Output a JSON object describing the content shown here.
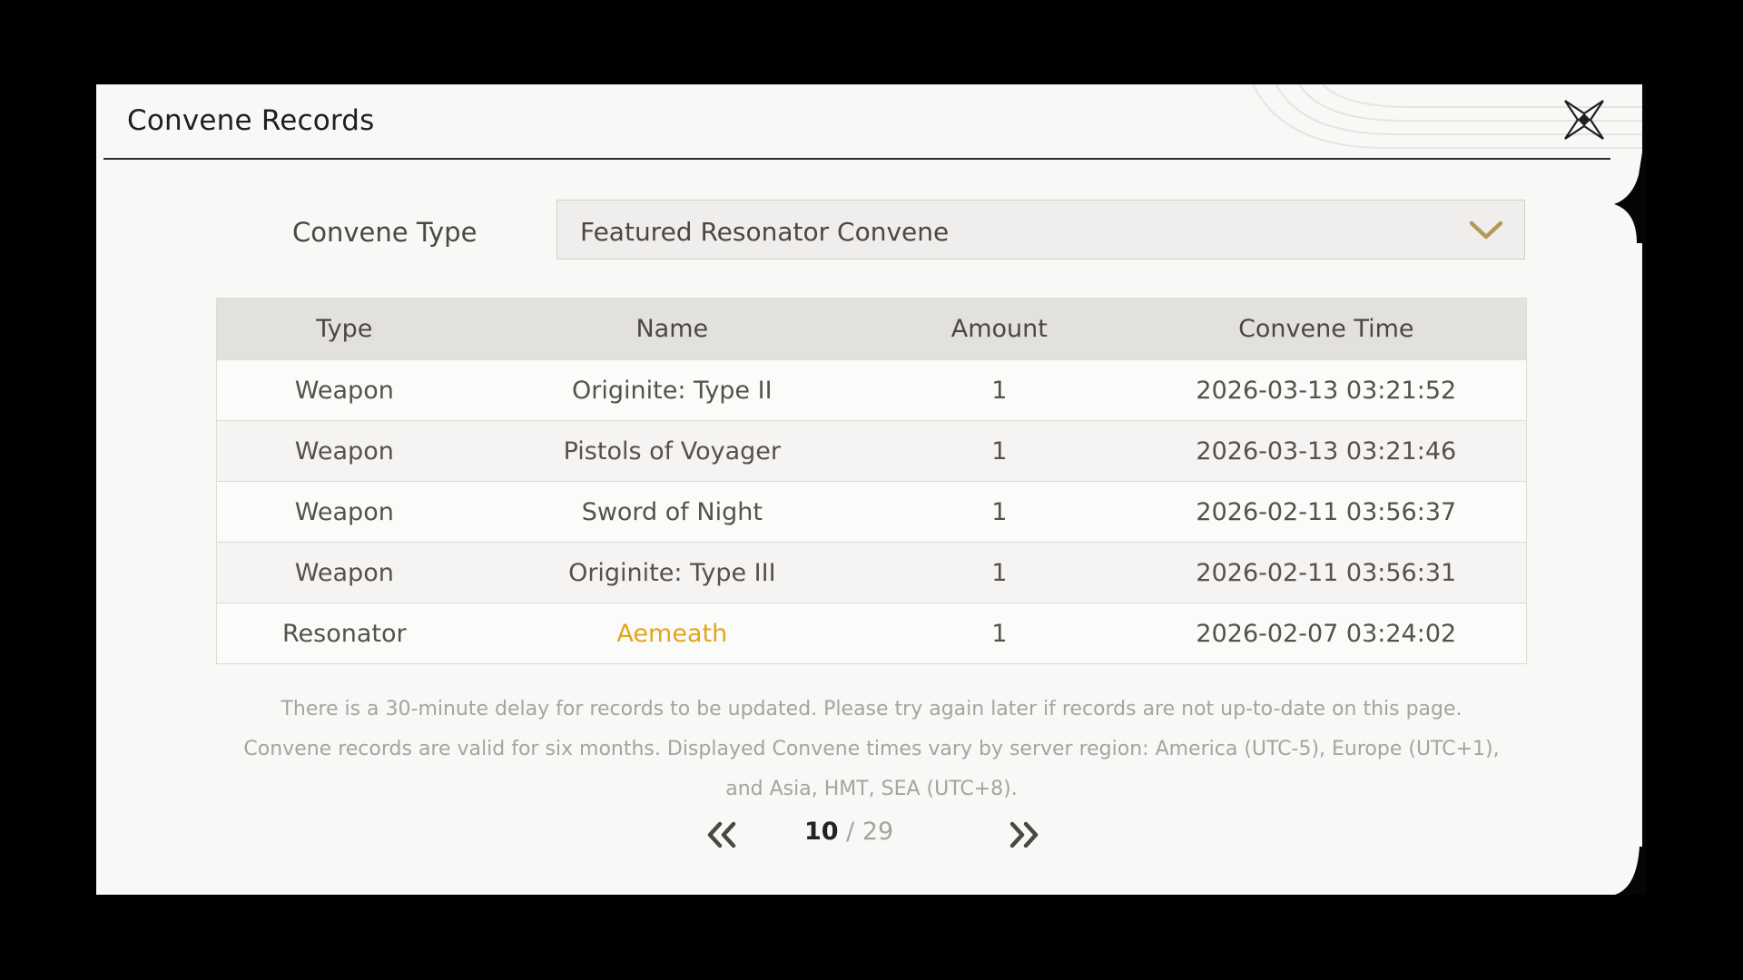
{
  "dialog": {
    "title": "Convene Records"
  },
  "filter": {
    "label": "Convene Type",
    "selected": "Featured Resonator Convene"
  },
  "table": {
    "columns": [
      "Type",
      "Name",
      "Amount",
      "Convene Time"
    ],
    "rows": [
      {
        "type": "Weapon",
        "name": "Originite: Type II",
        "amount": "1",
        "time": "2026-03-13 03:21:52"
      },
      {
        "type": "Weapon",
        "name": "Pistols of Voyager",
        "amount": "1",
        "time": "2026-03-13 03:21:46"
      },
      {
        "type": "Weapon",
        "name": "Sword of Night",
        "amount": "1",
        "time": "2026-02-11 03:56:37"
      },
      {
        "type": "Weapon",
        "name": "Originite: Type III",
        "amount": "1",
        "time": "2026-02-11 03:56:31"
      },
      {
        "type": "Resonator",
        "name": "Aemeath",
        "amount": "1",
        "time": "2026-02-07 03:24:02"
      }
    ]
  },
  "notice": {
    "line1": "There is a 30-minute delay for records to be updated. Please try again later if records are not up-to-date on this page.",
    "line2": "Convene records are valid for six months. Displayed Convene times vary by server region: America (UTC-5), Europe (UTC+1),",
    "line3": "and Asia, HMT, SEA (UTC+8)."
  },
  "pagination": {
    "current": "10",
    "separator": " / ",
    "total": "29"
  },
  "colors": {
    "highlight_name": "#e2a51c",
    "accent_gold": "#b39a5a"
  },
  "icons": {
    "close": "close-x-icon",
    "dropdown": "chevron-down-icon",
    "prev": "double-chevron-left-icon",
    "next": "double-chevron-right-icon"
  }
}
